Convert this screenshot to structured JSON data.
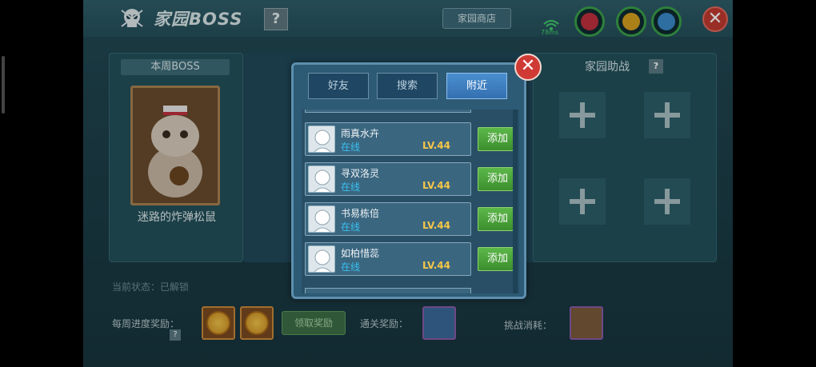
{
  "header": {
    "title": "家园BOSS",
    "help": "?",
    "shop_label": "家园商店",
    "ping": "78ms",
    "close": "✕"
  },
  "boss_panel": {
    "label": "本周BOSS",
    "name": "迷路的炸弹松鼠"
  },
  "helper_panel": {
    "title": "家园助战",
    "help": "?"
  },
  "bottom": {
    "status_label": "当前状态：",
    "status_value": "已解锁",
    "weekly_label": "每周进度奖励：",
    "weekly_help": "?",
    "claim_label": "领取奖励",
    "clear_label": "通关奖励：",
    "cost_label": "挑战消耗："
  },
  "modal": {
    "close": "✕",
    "tabs": [
      {
        "label": "好友",
        "active": false
      },
      {
        "label": "搜索",
        "active": false
      },
      {
        "label": "附近",
        "active": true
      }
    ],
    "players": [
      {
        "name": "雨真水卉",
        "status": "在线",
        "level": "LV.44",
        "action": "添加"
      },
      {
        "name": "寻双洛灵",
        "status": "在线",
        "level": "LV.44",
        "action": "添加"
      },
      {
        "name": "书易栋倍",
        "status": "在线",
        "level": "LV.44",
        "action": "添加"
      },
      {
        "name": "如柏惜蕊",
        "status": "在线",
        "level": "LV.44",
        "action": "添加"
      }
    ]
  },
  "colors": {
    "online": "#35c0f0",
    "level": "#f5c646",
    "add_button": "#5cb84a",
    "active_tab": "#4a8fd0"
  }
}
